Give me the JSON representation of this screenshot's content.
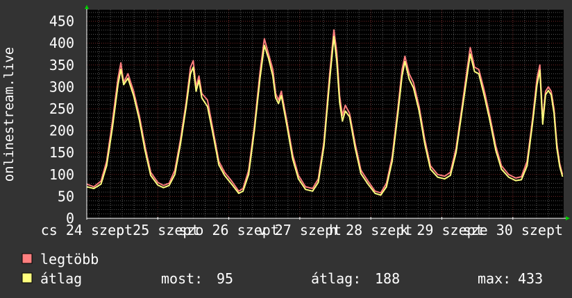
{
  "colors": {
    "background": "#333333",
    "plot_background": "#000000",
    "grid_minor": "#5a5a5a",
    "grid_major": "#7a2a2a",
    "axis": "#ffffff",
    "arrow": "#00d000",
    "legtobb": "#ff7f7f",
    "atlag": "#ffff7f"
  },
  "chart_data": {
    "type": "line",
    "ylabel": "onlinestream.live",
    "ylim": [
      0,
      470
    ],
    "yticks": [
      0,
      50,
      100,
      150,
      200,
      250,
      300,
      350,
      400,
      450
    ],
    "grid": true,
    "xticks": [
      {
        "x": 0,
        "label": "cs 24 szept"
      },
      {
        "x": 1,
        "label": "p 25 szept"
      },
      {
        "x": 2,
        "label": "szo 26 szept"
      },
      {
        "x": 3,
        "label": "v 27 szept"
      },
      {
        "x": 4,
        "label": "h 28 szept"
      },
      {
        "x": 5,
        "label": "k 29 szept"
      },
      {
        "x": 6,
        "label": "sze 30 szept"
      }
    ],
    "xrange": [
      0,
      6.58
    ],
    "series": [
      {
        "name": "legtöbb",
        "color": "#ff7f7f",
        "points": [
          [
            0,
            78
          ],
          [
            0.1,
            72
          ],
          [
            0.2,
            85
          ],
          [
            0.28,
            130
          ],
          [
            0.36,
            220
          ],
          [
            0.44,
            320
          ],
          [
            0.48,
            355
          ],
          [
            0.52,
            310
          ],
          [
            0.58,
            330
          ],
          [
            0.66,
            290
          ],
          [
            0.74,
            235
          ],
          [
            0.82,
            165
          ],
          [
            0.9,
            105
          ],
          [
            1.0,
            82
          ],
          [
            1.08,
            75
          ],
          [
            1.16,
            80
          ],
          [
            1.24,
            110
          ],
          [
            1.32,
            180
          ],
          [
            1.4,
            265
          ],
          [
            1.46,
            345
          ],
          [
            1.5,
            360
          ],
          [
            1.54,
            300
          ],
          [
            1.58,
            325
          ],
          [
            1.62,
            285
          ],
          [
            1.7,
            270
          ],
          [
            1.78,
            200
          ],
          [
            1.86,
            130
          ],
          [
            1.94,
            105
          ],
          [
            2.04,
            85
          ],
          [
            2.14,
            62
          ],
          [
            2.2,
            68
          ],
          [
            2.28,
            110
          ],
          [
            2.36,
            210
          ],
          [
            2.44,
            335
          ],
          [
            2.5,
            410
          ],
          [
            2.56,
            375
          ],
          [
            2.62,
            340
          ],
          [
            2.66,
            285
          ],
          [
            2.7,
            270
          ],
          [
            2.74,
            290
          ],
          [
            2.82,
            220
          ],
          [
            2.9,
            145
          ],
          [
            2.98,
            98
          ],
          [
            3.08,
            72
          ],
          [
            3.18,
            68
          ],
          [
            3.26,
            90
          ],
          [
            3.34,
            175
          ],
          [
            3.42,
            330
          ],
          [
            3.48,
            430
          ],
          [
            3.52,
            380
          ],
          [
            3.56,
            280
          ],
          [
            3.6,
            235
          ],
          [
            3.64,
            258
          ],
          [
            3.7,
            240
          ],
          [
            3.78,
            170
          ],
          [
            3.86,
            110
          ],
          [
            3.96,
            85
          ],
          [
            4.06,
            62
          ],
          [
            4.14,
            58
          ],
          [
            4.22,
            80
          ],
          [
            4.3,
            140
          ],
          [
            4.38,
            250
          ],
          [
            4.44,
            340
          ],
          [
            4.48,
            370
          ],
          [
            4.54,
            330
          ],
          [
            4.6,
            310
          ],
          [
            4.68,
            255
          ],
          [
            4.76,
            180
          ],
          [
            4.84,
            120
          ],
          [
            4.94,
            100
          ],
          [
            5.04,
            96
          ],
          [
            5.12,
            105
          ],
          [
            5.2,
            160
          ],
          [
            5.28,
            250
          ],
          [
            5.36,
            345
          ],
          [
            5.4,
            390
          ],
          [
            5.46,
            345
          ],
          [
            5.52,
            340
          ],
          [
            5.6,
            290
          ],
          [
            5.68,
            230
          ],
          [
            5.76,
            165
          ],
          [
            5.84,
            120
          ],
          [
            5.94,
            100
          ],
          [
            6.04,
            92
          ],
          [
            6.12,
            95
          ],
          [
            6.2,
            130
          ],
          [
            6.28,
            230
          ],
          [
            6.34,
            320
          ],
          [
            6.38,
            350
          ],
          [
            6.42,
            225
          ],
          [
            6.46,
            290
          ],
          [
            6.5,
            300
          ],
          [
            6.54,
            290
          ],
          [
            6.58,
            250
          ],
          [
            6.62,
            170
          ],
          [
            6.66,
            125
          ],
          [
            6.7,
            100
          ]
        ]
      },
      {
        "name": "átlag",
        "color": "#ffff7f",
        "points": [
          [
            0,
            72
          ],
          [
            0.1,
            68
          ],
          [
            0.2,
            78
          ],
          [
            0.28,
            120
          ],
          [
            0.36,
            205
          ],
          [
            0.44,
            305
          ],
          [
            0.48,
            340
          ],
          [
            0.52,
            305
          ],
          [
            0.58,
            320
          ],
          [
            0.66,
            280
          ],
          [
            0.74,
            225
          ],
          [
            0.82,
            155
          ],
          [
            0.9,
            98
          ],
          [
            1.0,
            76
          ],
          [
            1.08,
            70
          ],
          [
            1.16,
            75
          ],
          [
            1.24,
            100
          ],
          [
            1.32,
            170
          ],
          [
            1.4,
            255
          ],
          [
            1.46,
            330
          ],
          [
            1.5,
            345
          ],
          [
            1.54,
            290
          ],
          [
            1.58,
            315
          ],
          [
            1.62,
            275
          ],
          [
            1.7,
            255
          ],
          [
            1.78,
            190
          ],
          [
            1.86,
            122
          ],
          [
            1.94,
            98
          ],
          [
            2.04,
            78
          ],
          [
            2.14,
            57
          ],
          [
            2.2,
            62
          ],
          [
            2.28,
            100
          ],
          [
            2.36,
            200
          ],
          [
            2.44,
            320
          ],
          [
            2.5,
            395
          ],
          [
            2.56,
            365
          ],
          [
            2.62,
            325
          ],
          [
            2.66,
            275
          ],
          [
            2.7,
            262
          ],
          [
            2.74,
            280
          ],
          [
            2.82,
            210
          ],
          [
            2.9,
            135
          ],
          [
            2.98,
            90
          ],
          [
            3.08,
            66
          ],
          [
            3.18,
            62
          ],
          [
            3.26,
            82
          ],
          [
            3.34,
            165
          ],
          [
            3.42,
            315
          ],
          [
            3.48,
            415
          ],
          [
            3.52,
            360
          ],
          [
            3.56,
            265
          ],
          [
            3.6,
            222
          ],
          [
            3.64,
            245
          ],
          [
            3.7,
            232
          ],
          [
            3.78,
            160
          ],
          [
            3.86,
            102
          ],
          [
            3.96,
            78
          ],
          [
            4.06,
            57
          ],
          [
            4.14,
            53
          ],
          [
            4.22,
            72
          ],
          [
            4.3,
            130
          ],
          [
            4.38,
            238
          ],
          [
            4.44,
            325
          ],
          [
            4.48,
            358
          ],
          [
            4.54,
            318
          ],
          [
            4.6,
            298
          ],
          [
            4.68,
            245
          ],
          [
            4.76,
            170
          ],
          [
            4.84,
            112
          ],
          [
            4.94,
            94
          ],
          [
            5.04,
            90
          ],
          [
            5.12,
            98
          ],
          [
            5.2,
            150
          ],
          [
            5.28,
            240
          ],
          [
            5.36,
            330
          ],
          [
            5.4,
            375
          ],
          [
            5.46,
            335
          ],
          [
            5.52,
            330
          ],
          [
            5.6,
            278
          ],
          [
            5.68,
            220
          ],
          [
            5.76,
            155
          ],
          [
            5.84,
            112
          ],
          [
            5.94,
            94
          ],
          [
            6.04,
            86
          ],
          [
            6.12,
            88
          ],
          [
            6.2,
            120
          ],
          [
            6.28,
            220
          ],
          [
            6.34,
            305
          ],
          [
            6.38,
            338
          ],
          [
            6.42,
            215
          ],
          [
            6.46,
            282
          ],
          [
            6.5,
            292
          ],
          [
            6.54,
            282
          ],
          [
            6.58,
            240
          ],
          [
            6.62,
            160
          ],
          [
            6.66,
            118
          ],
          [
            6.7,
            95
          ]
        ]
      }
    ]
  },
  "legend": {
    "items": [
      {
        "label": "legtöbb"
      },
      {
        "label": "átlag"
      }
    ],
    "stats": {
      "most_label": "most:",
      "most_value": "95",
      "atlag_label": "átlag:",
      "atlag_value": "188",
      "max_label": "max:",
      "max_value": "433"
    }
  }
}
